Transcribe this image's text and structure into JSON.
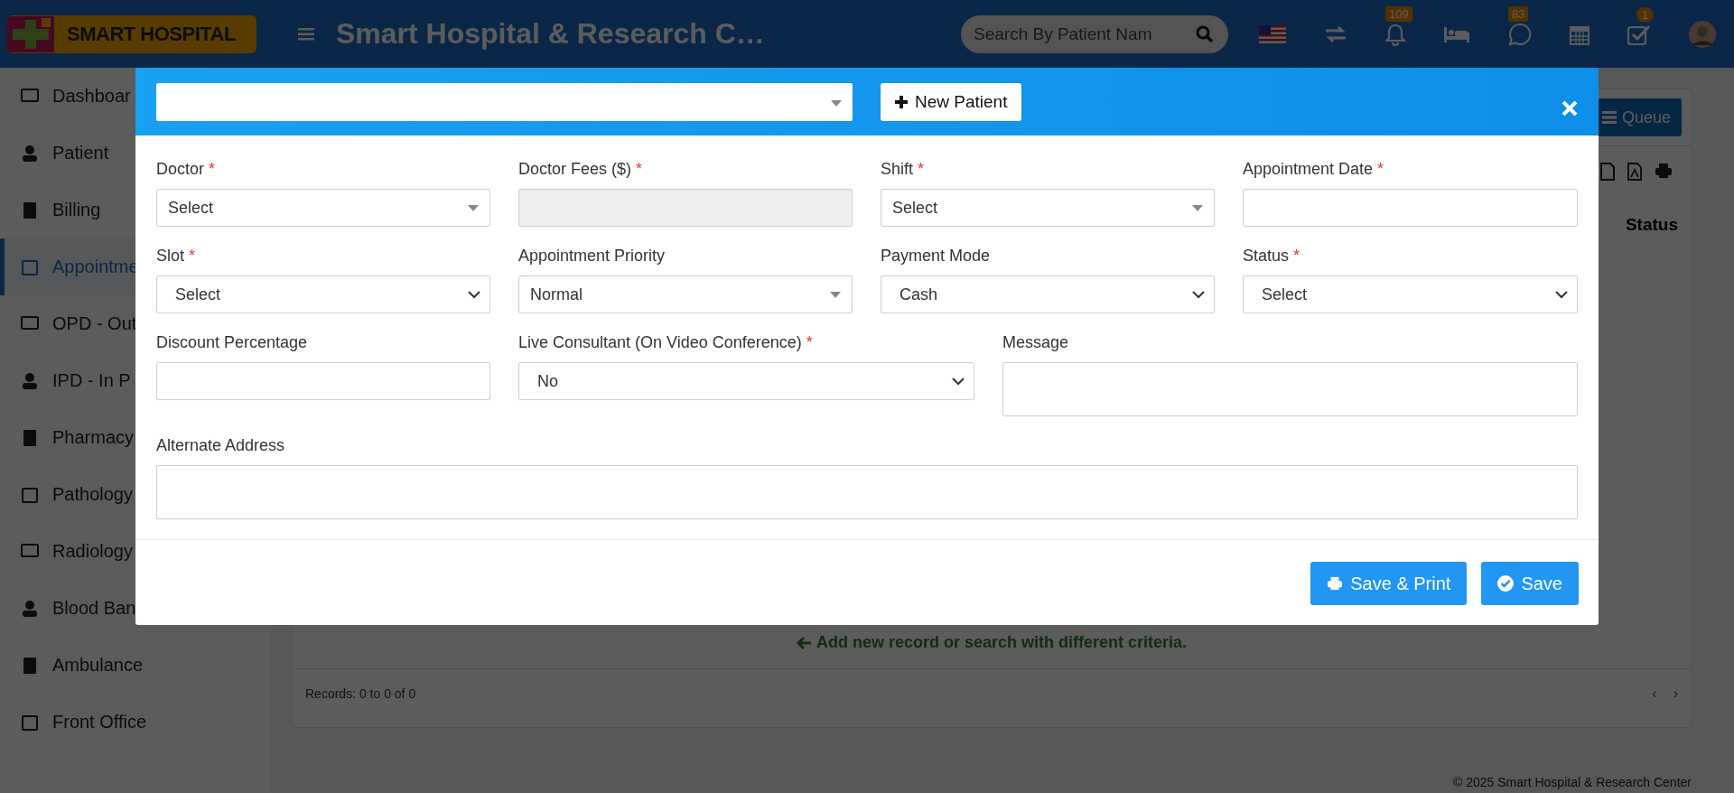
{
  "header": {
    "logo_text": "SMART HOSPITAL",
    "title": "Smart Hospital & Research C…",
    "search": {
      "placeholder": "Search By Patient Nam"
    },
    "badges": [
      "109",
      "83",
      "1"
    ]
  },
  "sidebar": {
    "items": [
      {
        "label": "Dashboar",
        "selected": false
      },
      {
        "label": "Patient",
        "selected": false
      },
      {
        "label": "Billing",
        "selected": false
      },
      {
        "label": "Appointme",
        "selected": true
      },
      {
        "label": "OPD - Out",
        "selected": false
      },
      {
        "label": "IPD - In P",
        "selected": false
      },
      {
        "label": "Pharmacy",
        "selected": false
      },
      {
        "label": "Pathology",
        "selected": false
      },
      {
        "label": "Radiology",
        "selected": false
      },
      {
        "label": "Blood Ban",
        "selected": false
      },
      {
        "label": "Ambulance",
        "selected": false
      },
      {
        "label": "Front Office",
        "selected": false
      }
    ]
  },
  "page": {
    "queue_button": "Queue",
    "table": {
      "columns": [
        "Status"
      ]
    },
    "empty_message": "Add new record or search with different criteria.",
    "records": "Records: 0 to 0 of 0",
    "pager": [
      "‹",
      "›"
    ]
  },
  "footer": "© 2025 Smart Hospital & Research Center",
  "modal": {
    "new_patient_button": "New Patient",
    "rows": [
      [
        {
          "label": "Doctor",
          "marker": "*",
          "kind": "select2",
          "value": "Select",
          "disabled": false
        },
        {
          "label": "Doctor Fees ($)",
          "marker": "*",
          "kind": "input",
          "disabled": true
        },
        {
          "label": "Shift",
          "marker": "*",
          "kind": "select2",
          "value": "Select",
          "disabled": false
        },
        {
          "label": "Appointment Date",
          "marker": "*",
          "kind": "input",
          "disabled": false
        }
      ],
      [
        {
          "label": "Slot",
          "marker": "*",
          "kind": "select",
          "value": "Select",
          "disabled": false
        },
        {
          "label": "Appointment Priority",
          "kind": "select2",
          "value": "Normal",
          "disabled": false
        },
        {
          "label": "Payment Mode",
          "kind": "select",
          "value": "Cash",
          "disabled": false
        },
        {
          "label": "Status",
          "marker": "*",
          "kind": "select",
          "value": "Select",
          "disabled": false
        }
      ],
      [
        {
          "label": "Discount Percentage",
          "kind": "input",
          "disabled": false
        },
        {
          "label": "Live Consultant (On Video Conference)",
          "marker": "*",
          "kind": "select",
          "value": "No",
          "disabled": false
        },
        {
          "label": "Message",
          "kind": "textarea",
          "disabled": false
        }
      ],
      [
        {
          "label": "Alternate Address",
          "kind": "textarea",
          "disabled": false
        }
      ]
    ],
    "buttons": [
      {
        "label": "Save & Print",
        "kind": "print"
      },
      {
        "label": "Save",
        "kind": "check"
      }
    ]
  }
}
